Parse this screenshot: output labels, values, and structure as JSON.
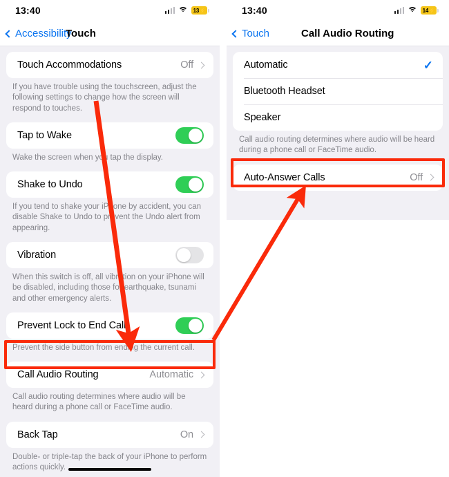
{
  "annotation": {
    "color": "#fa2a0a"
  },
  "left_phone": {
    "status": {
      "time": "13:40",
      "battery_level": "13",
      "charging_glyph": "⚡",
      "signal_icon": "cellular-signal-icon",
      "wifi_icon": "wifi-icon",
      "battery_icon": "battery-charging-icon"
    },
    "nav": {
      "back_label": "Accessibility",
      "title": "Touch",
      "back_icon": "chevron-left-icon"
    },
    "sections": [
      {
        "rows": [
          {
            "label": "Touch Accommodations",
            "value": "Off",
            "type": "disclosure"
          }
        ],
        "footnote": "If you have trouble using the touchscreen, adjust the following settings to change how the screen will respond to touches."
      },
      {
        "rows": [
          {
            "label": "Tap to Wake",
            "toggle": "on",
            "type": "switch"
          }
        ],
        "footnote": "Wake the screen when you tap the display."
      },
      {
        "rows": [
          {
            "label": "Shake to Undo",
            "toggle": "on",
            "type": "switch"
          }
        ],
        "footnote": "If you tend to shake your iPhone by accident, you can disable Shake to Undo to prevent the Undo alert from appearing."
      },
      {
        "rows": [
          {
            "label": "Vibration",
            "toggle": "off",
            "type": "switch"
          }
        ],
        "footnote": "When this switch is off, all vibration on your iPhone will be disabled, including those for earthquake, tsunami and other emergency alerts."
      },
      {
        "rows": [
          {
            "label": "Prevent Lock to End Call",
            "toggle": "on",
            "type": "switch"
          }
        ],
        "footnote": "Prevent the side button from ending the current call."
      },
      {
        "rows": [
          {
            "label": "Call Audio Routing",
            "value": "Automatic",
            "type": "disclosure"
          }
        ],
        "footnote": "Call audio routing determines where audio will be heard during a phone call or FaceTime audio."
      },
      {
        "rows": [
          {
            "label": "Back Tap",
            "value": "On",
            "type": "disclosure"
          }
        ],
        "footnote": "Double- or triple-tap the back of your iPhone to perform actions quickly."
      }
    ]
  },
  "right_phone": {
    "status": {
      "time": "13:40",
      "battery_level": "14",
      "charging_glyph": "⚡",
      "signal_icon": "cellular-signal-icon",
      "wifi_icon": "wifi-icon",
      "battery_icon": "battery-charging-icon"
    },
    "nav": {
      "back_label": "Touch",
      "title": "Call Audio Routing",
      "back_icon": "chevron-left-icon"
    },
    "sections": [
      {
        "rows": [
          {
            "label": "Automatic",
            "type": "check",
            "selected": true,
            "check_glyph": "✓"
          },
          {
            "label": "Bluetooth Headset",
            "type": "check",
            "selected": false
          },
          {
            "label": "Speaker",
            "type": "check",
            "selected": false
          }
        ],
        "footnote": "Call audio routing determines where audio will be heard during a phone call or FaceTime audio."
      },
      {
        "rows": [
          {
            "label": "Auto-Answer Calls",
            "value": "Off",
            "type": "disclosure"
          }
        ],
        "footnote": ""
      }
    ]
  }
}
